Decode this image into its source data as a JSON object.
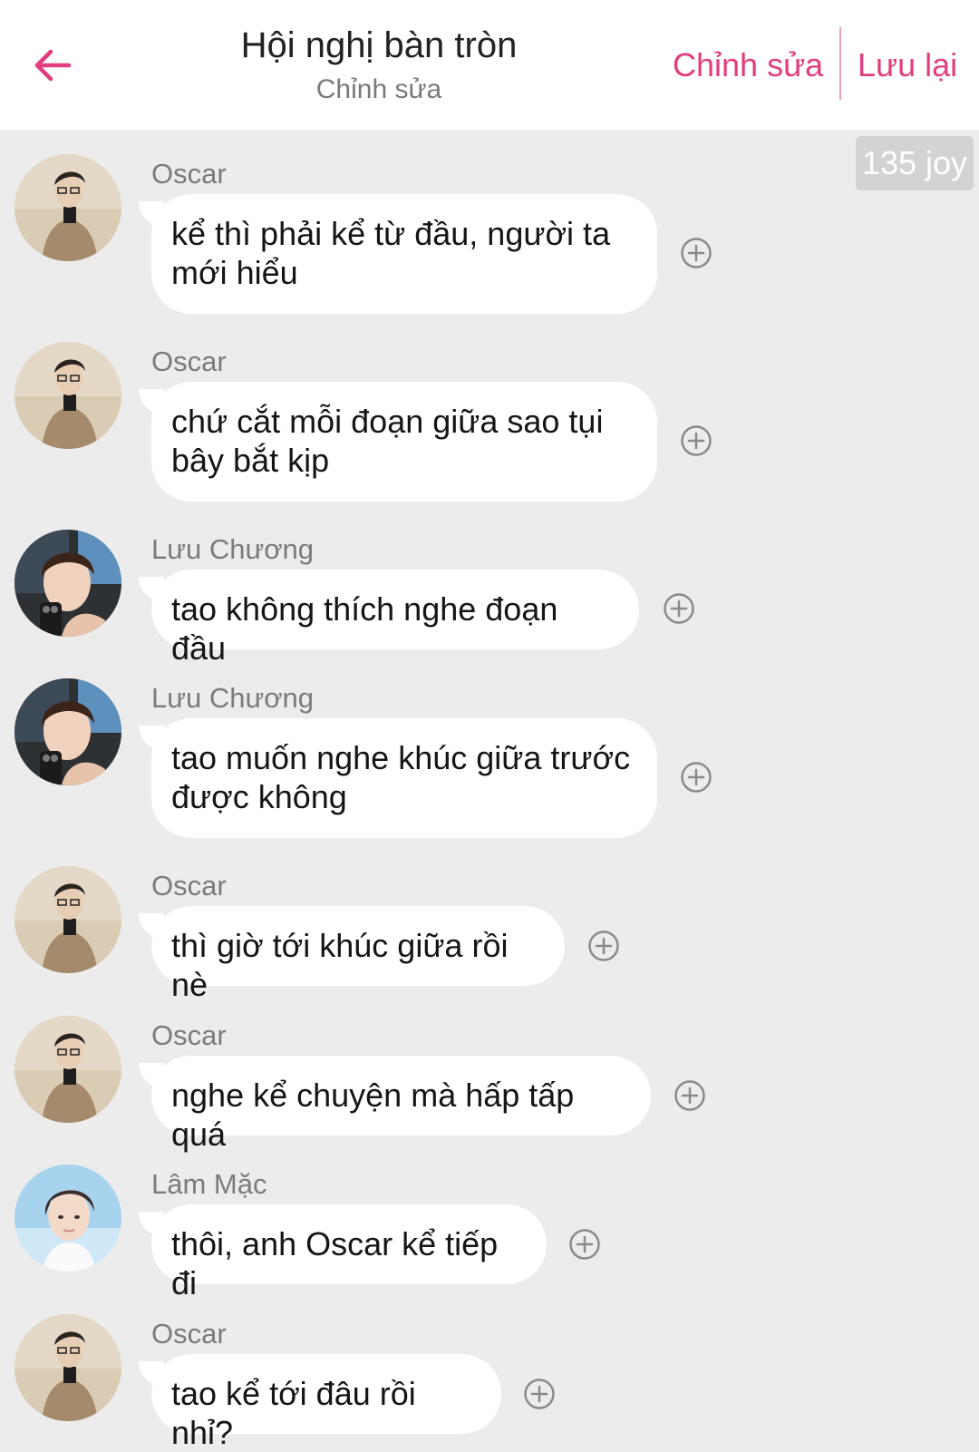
{
  "header": {
    "title": "Hội nghị bàn tròn",
    "subtitle": "Chỉnh sửa",
    "edit_label": "Chỉnh sửa",
    "save_label": "Lưu lại"
  },
  "joy_badge": "135 joy",
  "colors": {
    "accent": "#e23d7f",
    "background": "#ececec",
    "bubble": "#ffffff"
  },
  "messages": [
    {
      "sender": "Oscar",
      "text": "kể thì phải kể từ đầu, người ta mới hiểu",
      "avatar": "oscar-avatar"
    },
    {
      "sender": "Oscar",
      "text": "chứ cắt mỗi đoạn giữa sao tụi bây bắt kịp",
      "avatar": "oscar-avatar"
    },
    {
      "sender": "Lưu Chương",
      "text": "tao không thích nghe đoạn đầu",
      "avatar": "luu-chuong-avatar"
    },
    {
      "sender": "Lưu Chương",
      "text": "tao muốn nghe khúc giữa trước được không",
      "avatar": "luu-chuong-avatar"
    },
    {
      "sender": "Oscar",
      "text": "thì giờ tới khúc giữa rồi nè",
      "avatar": "oscar-avatar"
    },
    {
      "sender": "Oscar",
      "text": "nghe kể chuyện mà hấp tấp quá",
      "avatar": "oscar-avatar"
    },
    {
      "sender": "Lâm Mặc",
      "text": "thôi, anh Oscar kể tiếp đi",
      "avatar": "lam-mac-avatar"
    },
    {
      "sender": "Oscar",
      "text": "tao kể tới đâu rồi nhỉ?",
      "avatar": "oscar-avatar"
    }
  ]
}
